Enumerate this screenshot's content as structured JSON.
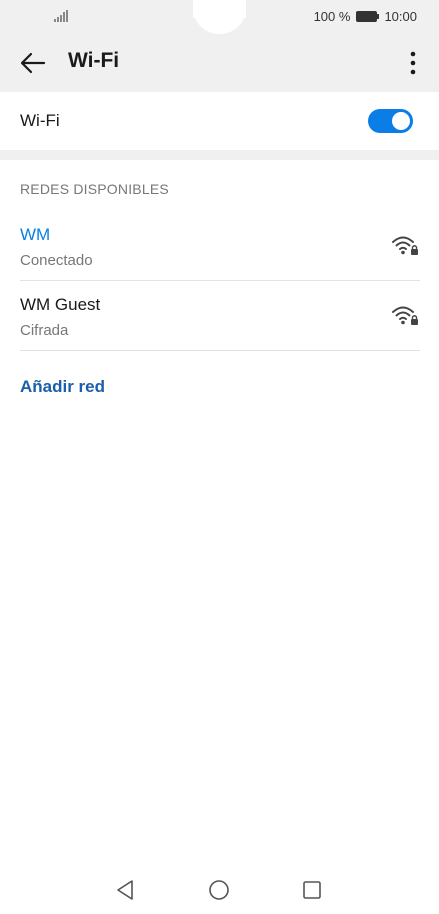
{
  "status_bar": {
    "battery_percent": "100 %",
    "time": "10:00"
  },
  "app_bar": {
    "title": "Wi-Fi",
    "back_icon": "arrow-left-icon",
    "more_icon": "more-vert-icon"
  },
  "wifi_toggle": {
    "label": "Wi-Fi",
    "enabled": true
  },
  "section": {
    "header": "REDES DISPONIBLES"
  },
  "networks": [
    {
      "name": "WM",
      "status": "Conectado",
      "connected": true,
      "icon": "wifi-locked-icon"
    },
    {
      "name": "WM Guest",
      "status": "Cifrada",
      "connected": false,
      "icon": "wifi-locked-icon"
    }
  ],
  "add_network": {
    "label": "Añadir red"
  },
  "colors": {
    "accent": "#0a7ee6",
    "connected_text": "#0a7ee6",
    "link": "#1a5fa8",
    "header_bg": "#f0f0f0"
  },
  "nav_bar": {
    "back_icon": "nav-back-icon",
    "home_icon": "nav-home-icon",
    "recent_icon": "nav-recent-icon"
  }
}
